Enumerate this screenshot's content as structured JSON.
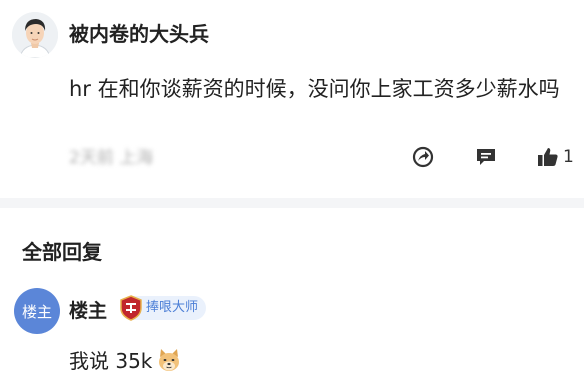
{
  "post": {
    "username": "被内卷的大头兵",
    "content": "hr 在和你谈薪资的时候，没问你上家工资多少薪水吗",
    "meta_text": "2天前 上海",
    "like_count": "1"
  },
  "replies_section": {
    "title": "全部回复"
  },
  "reply": {
    "avatar_text": "楼主",
    "username": "楼主",
    "badge_text": "捧哏大师",
    "text": "我说 35k"
  },
  "icons": {
    "share": "share-icon",
    "comment": "comment-icon",
    "like": "thumbs-up-icon",
    "emoji": "doge-emoji-icon",
    "badge": "badge-icon"
  },
  "colors": {
    "accent": "#4b7ed6",
    "badge_bg": "#eaf1fc",
    "floor_avatar_bg": "#5b86d8",
    "separator": "#f4f5f7"
  }
}
